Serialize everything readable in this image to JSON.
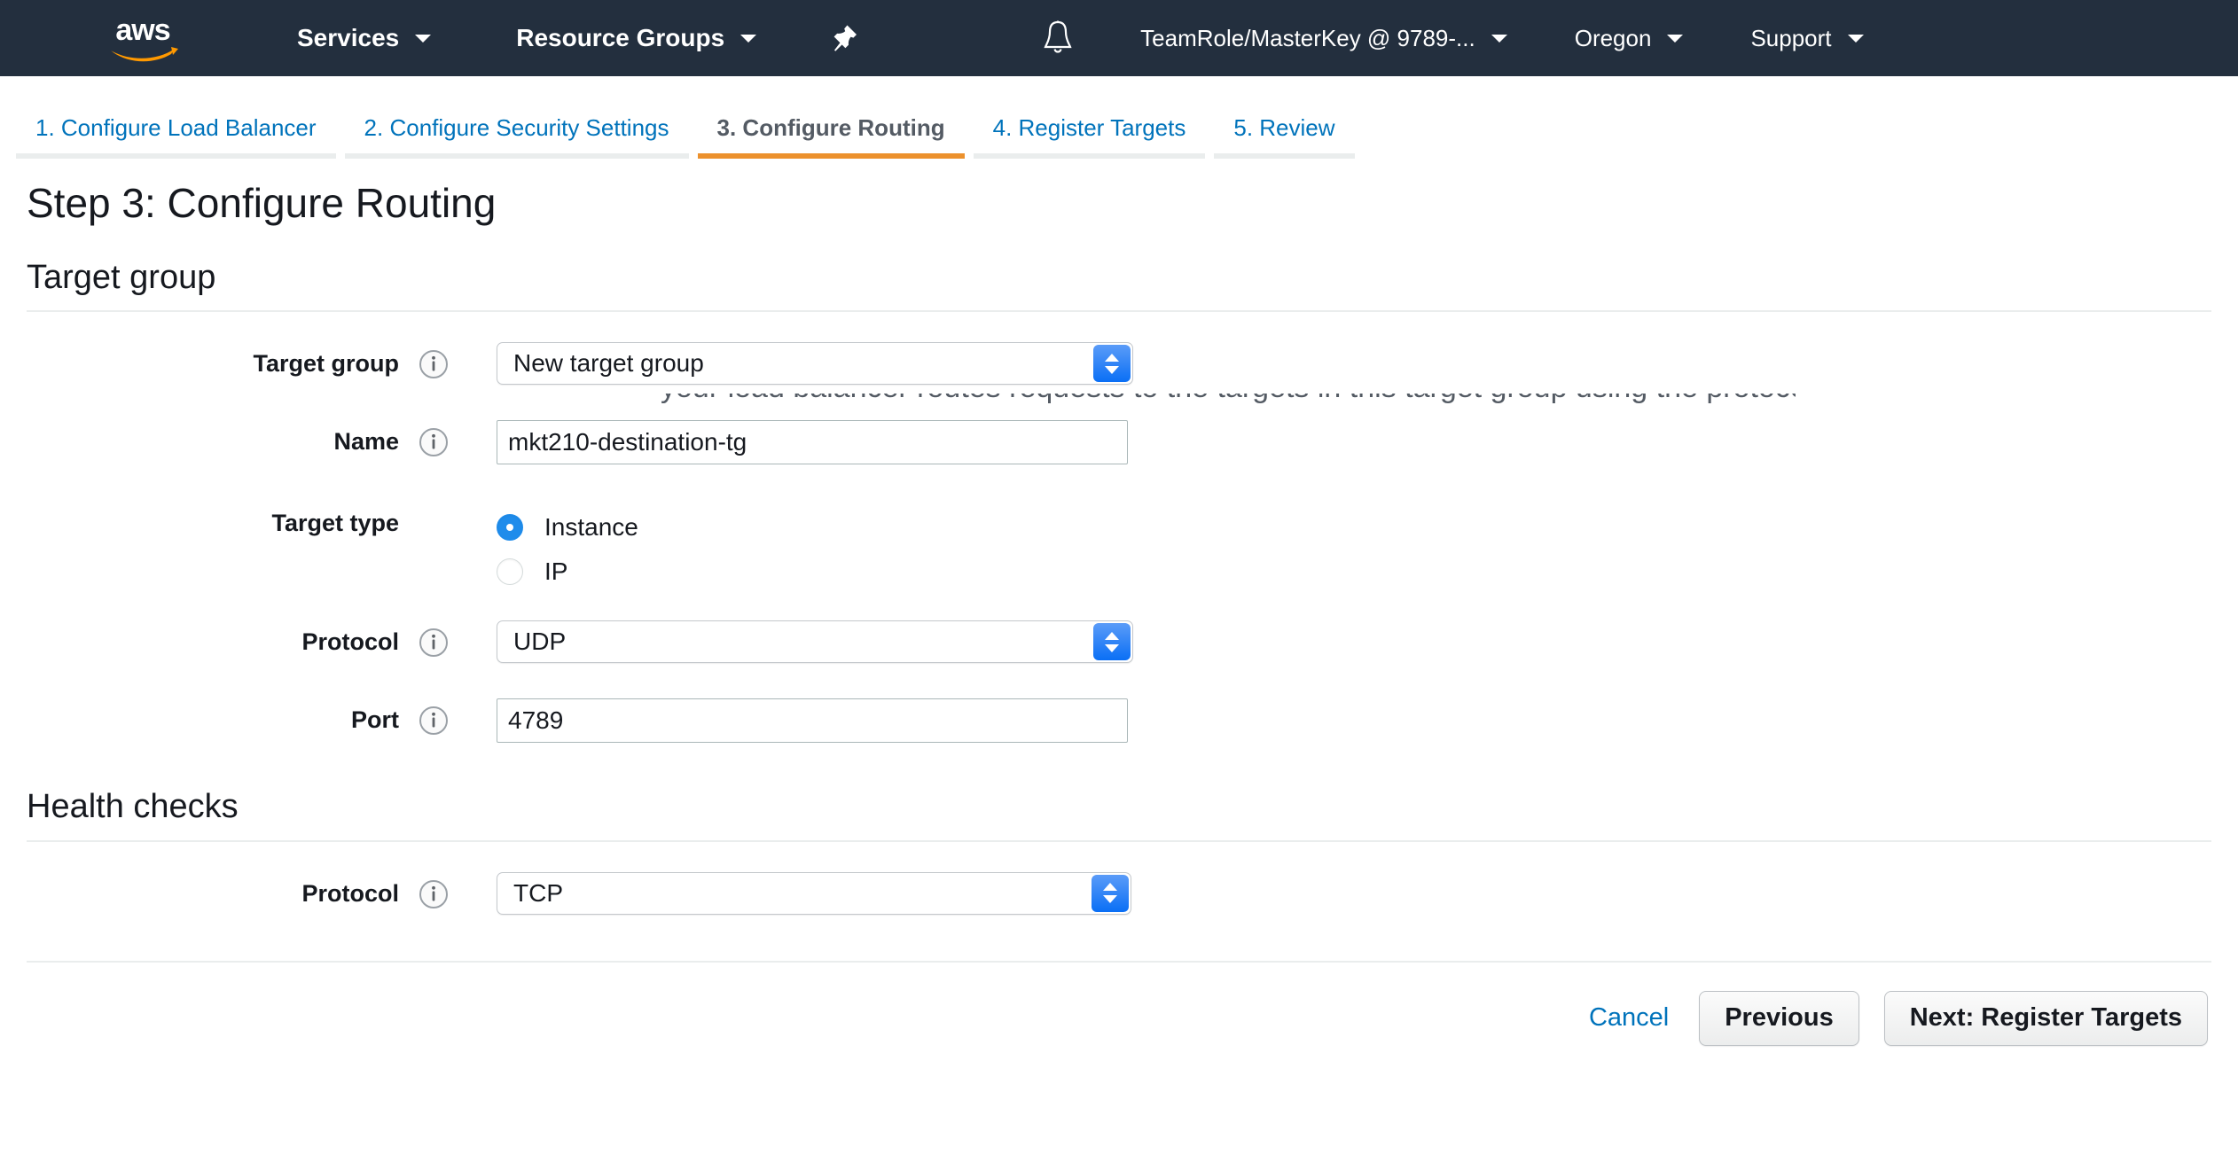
{
  "nav": {
    "logo_alt": "aws",
    "services_label": "Services",
    "resource_groups_label": "Resource Groups",
    "pin_icon": "pushpin-icon",
    "bell_icon": "bell-icon",
    "account_label": "TeamRole/MasterKey @ 9789-...",
    "region_label": "Oregon",
    "support_label": "Support",
    "bg_color": "#232f3e"
  },
  "wizard": {
    "tabs": [
      {
        "label": "1. Configure Load Balancer",
        "active": false
      },
      {
        "label": "2. Configure Security Settings",
        "active": false
      },
      {
        "label": "3. Configure Routing",
        "active": true
      },
      {
        "label": "4. Register Targets",
        "active": false
      },
      {
        "label": "5. Review",
        "active": false
      }
    ],
    "active_color": "#ec912d",
    "link_color": "#0073bb"
  },
  "page": {
    "title": "Step 3: Configure Routing",
    "ghost_text": "your load balancer routes requests to the targets in this target group using the protocol and port that you specify"
  },
  "target_group_section": {
    "heading": "Target group",
    "fields": {
      "target_group": {
        "label": "Target group",
        "info_icon": "info-icon",
        "type": "select",
        "value": "New target group"
      },
      "name": {
        "label": "Name",
        "info_icon": "info-icon",
        "type": "text",
        "value": "mkt210-destination-tg"
      },
      "target_type": {
        "label": "Target type",
        "type": "radio",
        "options": [
          {
            "label": "Instance",
            "selected": true
          },
          {
            "label": "IP",
            "selected": false
          }
        ]
      },
      "protocol": {
        "label": "Protocol",
        "info_icon": "info-icon",
        "type": "select",
        "value": "UDP"
      },
      "port": {
        "label": "Port",
        "info_icon": "info-icon",
        "type": "text",
        "value": "4789"
      }
    }
  },
  "health_checks_section": {
    "heading": "Health checks",
    "fields": {
      "protocol": {
        "label": "Protocol",
        "info_icon": "info-icon",
        "type": "select",
        "value": "TCP"
      }
    }
  },
  "footer": {
    "cancel_label": "Cancel",
    "previous_label": "Previous",
    "next_label": "Next: Register Targets"
  }
}
